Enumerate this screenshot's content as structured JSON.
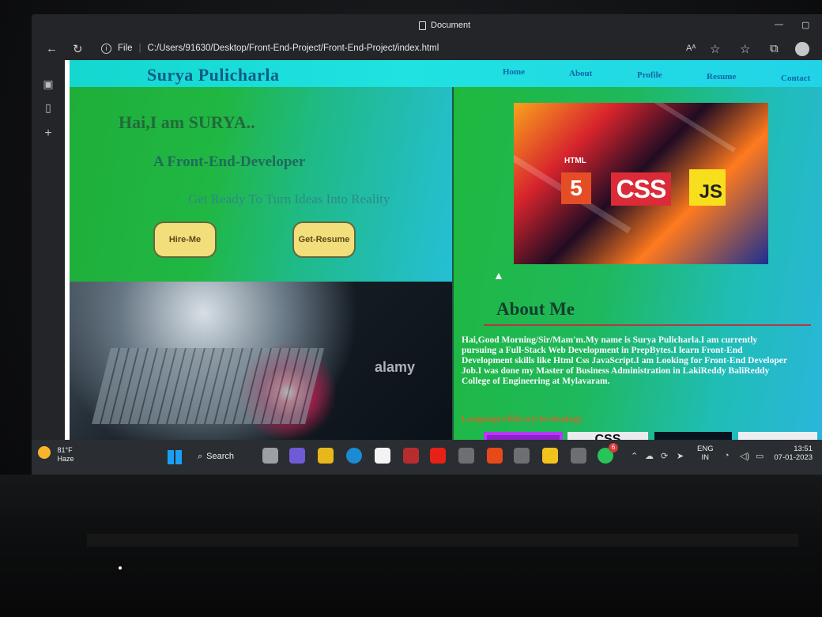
{
  "browser": {
    "window_title": "Document",
    "address_label": "File",
    "address_path": "C:/Users/91630/Desktop/Front-End-Project/Front-End-Project/index.html",
    "reader_label": "Aᴬ"
  },
  "site": {
    "brand": "Surya Pulicharla",
    "menu": [
      "Home",
      "About",
      "Profile",
      "Resume",
      "Contact"
    ],
    "hero": {
      "greeting": "Hai,I am SURYA..",
      "role": "A Front-End-Developer",
      "tagline": "Get Ready To Turn Ideas Into Reality",
      "hire_label": "Hire-Me",
      "resume_label": "Get-Resume"
    },
    "photo_watermark": "alamy",
    "tech_banner": {
      "html_caption": "HTML",
      "html_number": "5",
      "css_label": "CSS",
      "js_label": "JS"
    },
    "about": {
      "title": "About Me",
      "text": "Hai,Good Morning/Sir/Mam'm.My name is Surya Pulicharla.I am currently pursuing a Full-Stack Web Development in PrepBytes.I learn Front-End Development skills like Html Css JavaScript.I am Looking for Front-End Developer Job.I was done my Master of Business Administration in LakiReddy BaliReddy College of Engineering at Mylavaram.",
      "languages_label": "Languages/library/technology",
      "css_tile_label": "CSS"
    }
  },
  "taskbar": {
    "temperature": "81°F",
    "condition": "Haze",
    "search_label": "Search",
    "language": "ENG",
    "region": "IN",
    "time": "13:51",
    "date": "07-01-2023",
    "notification_count": "6"
  },
  "colors": {
    "header_cyan": "#20e2e0",
    "hero_green": "#20b743",
    "button_yellow": "#f3de7c",
    "about_divider": "#b63744",
    "taskbar": "#2a2d31"
  }
}
